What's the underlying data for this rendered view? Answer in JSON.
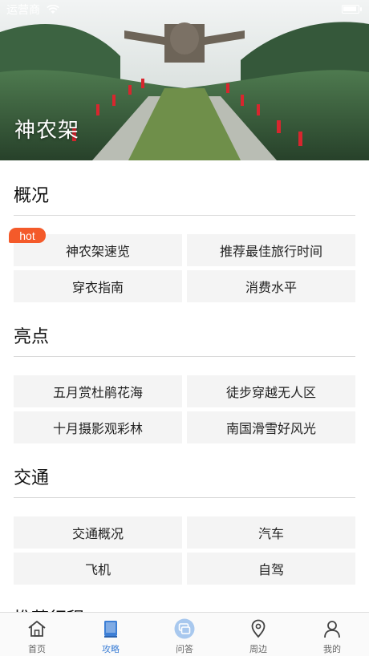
{
  "status_bar": {
    "carrier": "运营商"
  },
  "hero": {
    "title": "神农架"
  },
  "sections": [
    {
      "title": "概况",
      "badge": "hot",
      "items": [
        "神农架速览",
        "推荐最佳旅行时间",
        "穿衣指南",
        "消费水平"
      ]
    },
    {
      "title": "亮点",
      "items": [
        "五月赏杜鹃花海",
        "徒步穿越无人区",
        "十月摄影观彩林",
        "南国滑雪好风光"
      ]
    },
    {
      "title": "交通",
      "items": [
        "交通概况",
        "汽车",
        "飞机",
        "自驾"
      ]
    },
    {
      "title": "推荐行程"
    }
  ],
  "tabbar": {
    "active_index": 1,
    "active_color": "#3d7fd6",
    "tabs": [
      {
        "label": "首页",
        "icon": "home-icon"
      },
      {
        "label": "攻略",
        "icon": "guide-book-icon"
      },
      {
        "label": "问答",
        "icon": "qa-chat-icon"
      },
      {
        "label": "周边",
        "icon": "location-pin-icon"
      },
      {
        "label": "我的",
        "icon": "profile-icon"
      }
    ]
  }
}
